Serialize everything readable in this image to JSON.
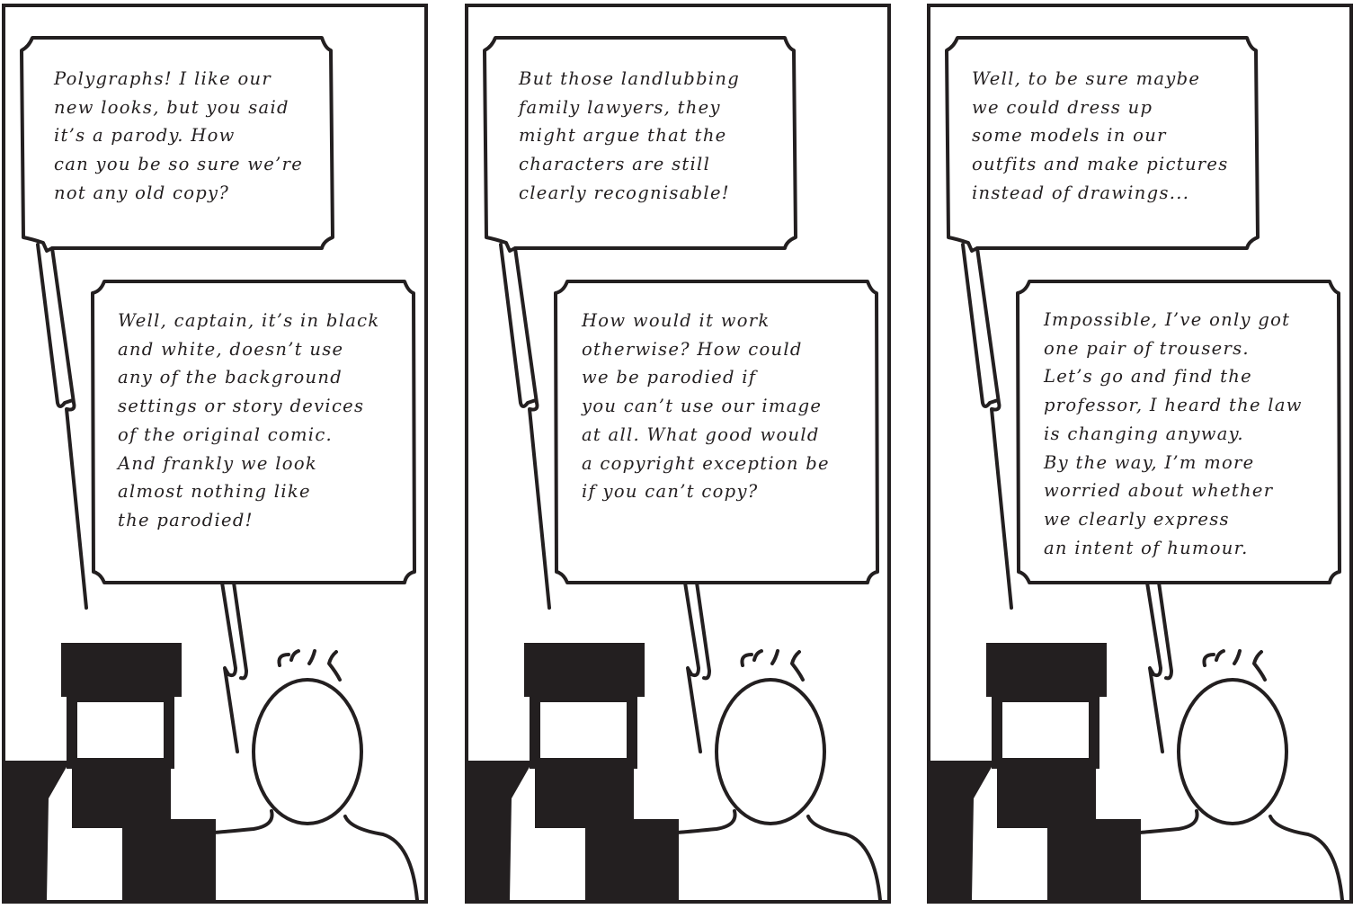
{
  "colors": {
    "ink": "#231f20",
    "paper": "#ffffff"
  },
  "panels": [
    {
      "top_text": "Polygraphs! I like our\nnew looks, but you said\nit’s a parody. How\ncan you be so sure we’re\nnot any old copy?",
      "bottom_text": "Well, captain, it’s in black\nand white, doesn’t use\nany of the background\nsettings or story devices\nof the original comic.\nAnd frankly we look\nalmost nothing like\nthe parodied!"
    },
    {
      "top_text": "But those landlubbing\nfamily lawyers, they\nmight argue that the\ncharacters are still\nclearly recognisable!",
      "bottom_text": "How would it work\notherwise? How could\nwe be parodied if\nyou can’t use our image\nat all. What good would\na copyright exception be\nif you can’t copy?"
    },
    {
      "top_text": "Well, to be sure maybe\nwe could dress up\nsome models in our\noutfits and make pictures\ninstead of drawings...",
      "bottom_text": "Impossible, I’ve only got\none pair of trousers.\nLet’s go and find the\nprofessor, I heard the law\nis changing anyway.\nBy the way, I’m more\nworried about whether\nwe clearly express\nan intent of humour."
    }
  ]
}
